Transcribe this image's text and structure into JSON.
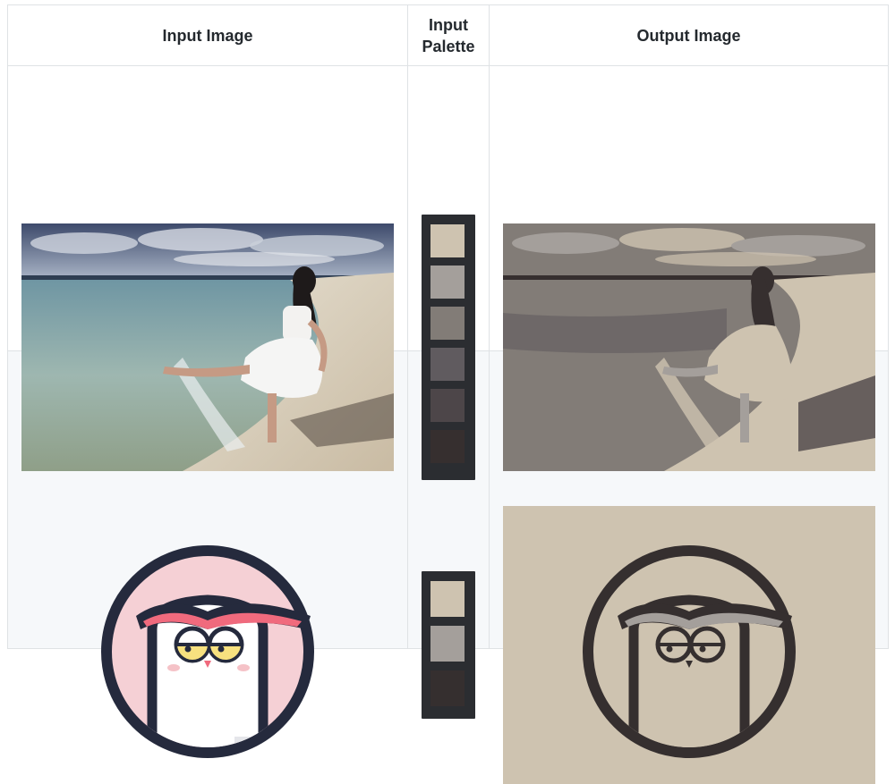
{
  "table": {
    "headers": [
      "Input Image",
      "Input\nPalette",
      "Output Image"
    ],
    "header_input_image": "Input Image",
    "header_palette_line1": "Input",
    "header_palette_line2": "Palette",
    "header_output_image": "Output Image"
  },
  "rows": [
    {
      "input_image": "beach-photo",
      "palette_colors": [
        "#cec3b0",
        "#a49f9b",
        "#827c77",
        "#605b5f",
        "#4d4649",
        "#362f2f"
      ],
      "output_image": "beach-photo-recolored"
    },
    {
      "input_image": "owl-logo",
      "palette_colors": [
        "#cec3b0",
        "#a49f9b",
        "#352f2f"
      ],
      "output_image": "owl-logo-recolored"
    }
  ],
  "colors": {
    "border": "#dfe2e5",
    "alt_row_bg": "#f6f8fa",
    "palette_frame": "#2b2d31",
    "owl_pink": "#f5d0d5",
    "owl_dark": "#252a3d",
    "owl_brow": "#f06a7d",
    "owl_eye": "#f7e17f",
    "output_bg": "#cec3b0",
    "output_dark": "#352f2f",
    "output_mid": "#a49f9b"
  }
}
